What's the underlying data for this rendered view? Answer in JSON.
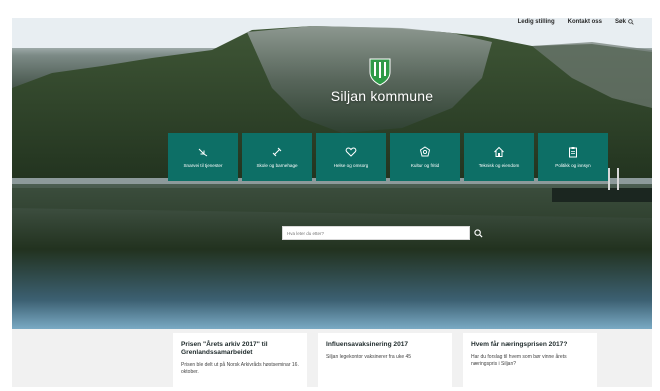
{
  "nav": {
    "links": [
      "Ledig stilling",
      "Kontakt oss",
      "Søk"
    ]
  },
  "hero": {
    "title": "Siljan kommune",
    "tiles": [
      {
        "label": "Snarvei til tjenester",
        "icon": "shortcut-icon"
      },
      {
        "label": "Skole og barnehage",
        "icon": "school-icon"
      },
      {
        "label": "Helse og omsorg",
        "icon": "heart-icon"
      },
      {
        "label": "Kultur og fritid",
        "icon": "culture-icon"
      },
      {
        "label": "Teknisk og eiendom",
        "icon": "house-icon"
      },
      {
        "label": "Politikk og innsyn",
        "icon": "clipboard-icon"
      }
    ],
    "search_placeholder": "Hva leter du etter?"
  },
  "news": [
    {
      "title": "Prisen \"Årets arkiv 2017\" til Grenlandssamarbeidet",
      "text": "Prisen ble delt ut på Norsk Arkivråds høstseminar 16. oktober."
    },
    {
      "title": "Influensavaksinering 2017",
      "text": "Siljan legekontor vaksinerer fra uke 45"
    },
    {
      "title": "Hvem får næringsprisen 2017?",
      "text": "Har du forslag til hvem som bør vinne årets næringspris i Siljan?"
    }
  ],
  "colors": {
    "tile": "#0d6f66",
    "brand": "#2e9a47"
  }
}
